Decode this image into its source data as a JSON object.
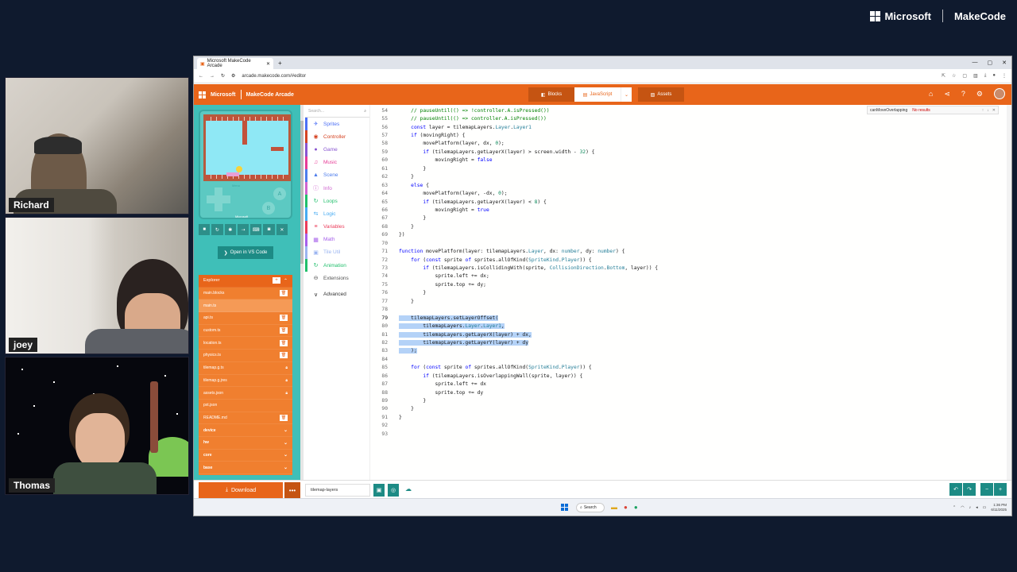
{
  "stream": {
    "brand_company": "Microsoft",
    "brand_product": "MakeCode",
    "participants": [
      "Richard",
      "joey",
      "Thomas"
    ]
  },
  "browser": {
    "tab_title": "Microsoft MakeCode Arcade",
    "url": "arcade.makecode.com/#editor"
  },
  "header": {
    "brand_company": "Microsoft",
    "brand_app": "MakeCode Arcade",
    "modes": {
      "blocks": "Blocks",
      "javascript": "JavaScript",
      "assets": "Assets"
    }
  },
  "simulator": {
    "menu_label": "Menu",
    "a_label": "A",
    "b_label": "B",
    "logo_text": "Microsoft",
    "vscode_label": "Open in VS Code"
  },
  "explorer": {
    "title": "Explorer",
    "files": [
      {
        "name": "main.blocks",
        "icon": "trash"
      },
      {
        "name": "main.ts",
        "icon": "",
        "selected": true
      },
      {
        "name": "api.ts",
        "icon": "trash"
      },
      {
        "name": "custom.ts",
        "icon": "trash"
      },
      {
        "name": "location.ts",
        "icon": "trash"
      },
      {
        "name": "physics.ts",
        "icon": "trash"
      },
      {
        "name": "tilemap.g.ts",
        "icon": "lock"
      },
      {
        "name": "tilemap.g.jres",
        "icon": "lock"
      },
      {
        "name": "assets.json",
        "icon": "lock"
      },
      {
        "name": "pxt.json",
        "icon": ""
      },
      {
        "name": "README.md",
        "icon": "trash"
      }
    ],
    "packages": [
      "device",
      "hw",
      "core",
      "base"
    ]
  },
  "toolbox": {
    "search_placeholder": "Search...",
    "categories": [
      {
        "label": "Sprites",
        "color": "#4b6ef5",
        "icon": "✈"
      },
      {
        "label": "Controller",
        "color": "#d54322",
        "icon": "◉"
      },
      {
        "label": "Game",
        "color": "#8854d0",
        "icon": "●"
      },
      {
        "label": "Music",
        "color": "#e63a96",
        "icon": "♫"
      },
      {
        "label": "Scene",
        "color": "#4b7bec",
        "icon": "▲"
      },
      {
        "label": "Info",
        "color": "#cf63cf",
        "icon": "ⓘ"
      },
      {
        "label": "Loops",
        "color": "#20bf6b",
        "icon": "↻"
      },
      {
        "label": "Logic",
        "color": "#45aaf2",
        "icon": "⇆"
      },
      {
        "label": "Variables",
        "color": "#eb3b5a",
        "icon": "≡"
      },
      {
        "label": "Math",
        "color": "#a55eea",
        "icon": "▦"
      },
      {
        "label": "Tile Util",
        "color": "#9ab4f0",
        "icon": "▣"
      },
      {
        "label": "Animation",
        "color": "#20bf6b",
        "icon": "↻"
      },
      {
        "label": "Extensions",
        "color": "#555555",
        "icon": "⊖"
      },
      {
        "label": "Advanced",
        "color": "#333333",
        "icon": "∨"
      }
    ]
  },
  "find_widget": {
    "query": "canMoveOverlapping",
    "result": "No results"
  },
  "code_lines": [
    {
      "n": "54",
      "html": "    <span class='cm'>// pauseUntil(() =&gt; !controller.A.isPressed())</span>"
    },
    {
      "n": "55",
      "html": "    <span class='cm'>// pauseUntil(() =&gt; controller.A.isPressed())</span>"
    },
    {
      "n": "56",
      "html": "    <span class='kw'>const</span> layer = tilemapLayers.<span class='ty'>Layer</span>.<span class='ty'>Layer1</span>"
    },
    {
      "n": "57",
      "html": "    <span class='kw'>if</span> (movingRight) {"
    },
    {
      "n": "58",
      "html": "        movePlatform(layer, dx, <span class='num'>0</span>);"
    },
    {
      "n": "59",
      "html": "        <span class='kw'>if</span> (tilemapLayers.getLayerX(layer) &gt; screen.width - <span class='num'>32</span>) {"
    },
    {
      "n": "60",
      "html": "            movingRight = <span class='kw'>false</span>"
    },
    {
      "n": "61",
      "html": "        }"
    },
    {
      "n": "62",
      "html": "    }"
    },
    {
      "n": "63",
      "html": "    <span class='kw'>else</span> {"
    },
    {
      "n": "64",
      "html": "        movePlatform(layer, -dx, <span class='num'>0</span>);"
    },
    {
      "n": "65",
      "html": "        <span class='kw'>if</span> (tilemapLayers.getLayerX(layer) &lt; <span class='num'>8</span>) {"
    },
    {
      "n": "66",
      "html": "            movingRight = <span class='kw'>true</span>"
    },
    {
      "n": "67",
      "html": "        }"
    },
    {
      "n": "68",
      "html": "    }"
    },
    {
      "n": "69",
      "html": "})"
    },
    {
      "n": "70",
      "html": ""
    },
    {
      "n": "71",
      "html": "<span class='kw'>function</span> movePlatform(layer: tilemapLayers.<span class='ty'>Layer</span>, dx: <span class='ty'>number</span>, dy: <span class='ty'>number</span>) {"
    },
    {
      "n": "72",
      "html": "    <span class='kw'>for</span> (<span class='kw'>const</span> sprite <span class='kw'>of</span> sprites.allOfKind(<span class='ty'>SpriteKind</span>.<span class='ty'>Player</span>)) {"
    },
    {
      "n": "73",
      "html": "        <span class='kw'>if</span> (tilemapLayers.isCollidingWith(sprite, <span class='ty'>CollisionDirection</span>.<span class='ty'>Bottom</span>, layer)) {"
    },
    {
      "n": "74",
      "html": "            sprite.left += dx;"
    },
    {
      "n": "75",
      "html": "            sprite.top += dy;"
    },
    {
      "n": "76",
      "html": "        }"
    },
    {
      "n": "77",
      "html": "    }"
    },
    {
      "n": "78",
      "html": ""
    },
    {
      "n": "79",
      "html": "<span class='sel'>    tilemapLayers.setLayerOffset(</span>",
      "hl": true
    },
    {
      "n": "80",
      "html": "<span class='sel'>        tilemapLayers.<span class='ty'>Layer</span>.<span class='ty'>Layer1</span>,</span>",
      "hl": true
    },
    {
      "n": "81",
      "html": "<span class='sel'>        tilemapLayers.getLayerX(layer) + dx,</span>",
      "hl": true
    },
    {
      "n": "82",
      "html": "<span class='sel'>        tilemapLayers.getLayerY(layer) + dy</span>",
      "hl": true
    },
    {
      "n": "83",
      "html": "<span class='sel'>    );</span>",
      "hl": true
    },
    {
      "n": "84",
      "html": ""
    },
    {
      "n": "85",
      "html": "    <span class='kw'>for</span> (<span class='kw'>const</span> sprite <span class='kw'>of</span> sprites.allOfKind(<span class='ty'>SpriteKind</span>.<span class='ty'>Player</span>)) {"
    },
    {
      "n": "86",
      "html": "        <span class='kw'>if</span> (tilemapLayers.isOverlappingWall(sprite, layer)) {"
    },
    {
      "n": "87",
      "html": "            sprite.left += dx"
    },
    {
      "n": "88",
      "html": "            sprite.top += dy"
    },
    {
      "n": "89",
      "html": "        }"
    },
    {
      "n": "90",
      "html": "    }"
    },
    {
      "n": "91",
      "html": "}"
    },
    {
      "n": "92",
      "html": ""
    },
    {
      "n": "93",
      "html": ""
    }
  ],
  "bottom": {
    "download_label": "Download",
    "project_name": "tilemap-layers"
  },
  "taskbar": {
    "search_label": "Search",
    "time": "1:36 PM",
    "date": "6/11/2025"
  }
}
